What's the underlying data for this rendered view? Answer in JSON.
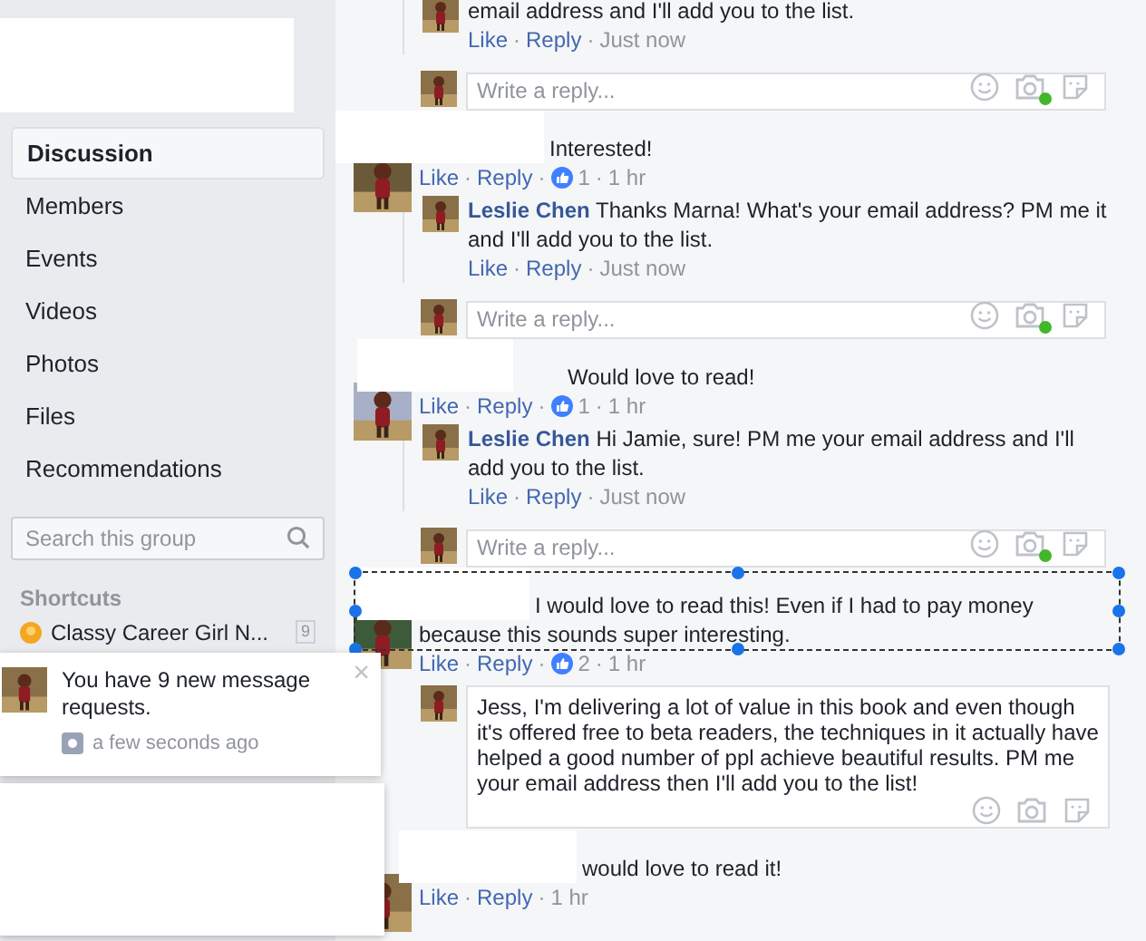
{
  "sidebar": {
    "nav": [
      {
        "label": "Discussion",
        "selected": true
      },
      {
        "label": "Members",
        "selected": false
      },
      {
        "label": "Events",
        "selected": false
      },
      {
        "label": "Videos",
        "selected": false
      },
      {
        "label": "Photos",
        "selected": false
      },
      {
        "label": "Files",
        "selected": false
      },
      {
        "label": "Recommendations",
        "selected": false
      }
    ],
    "search": {
      "placeholder": "Search this group"
    },
    "shortcuts": {
      "title": "Shortcuts",
      "items": [
        {
          "name": "Classy Career Girl N...",
          "count": "9"
        }
      ]
    }
  },
  "notification": {
    "text": "You have 9 new message requests.",
    "time": "a few seconds ago",
    "close": "×"
  },
  "earlier": {
    "reply": {
      "text": "email address and I'll add you to the list.",
      "actions": [
        {
          "kind": "link",
          "text": "Like"
        },
        {
          "kind": "sep",
          "text": "·"
        },
        {
          "kind": "link",
          "text": "Reply"
        },
        {
          "kind": "sep",
          "text": "·"
        },
        {
          "kind": "time",
          "text": "Just now"
        }
      ]
    },
    "composer": {
      "placeholder": "Write a reply...",
      "online": true
    }
  },
  "comments": [
    {
      "text": "Interested!",
      "selected": false,
      "actions": [
        {
          "kind": "link",
          "text": "Like"
        },
        {
          "kind": "sep",
          "text": "·"
        },
        {
          "kind": "link",
          "text": "Reply"
        },
        {
          "kind": "sep",
          "text": "·"
        },
        {
          "kind": "reactions",
          "text": "1"
        },
        {
          "kind": "sep",
          "text": "·"
        },
        {
          "kind": "time",
          "text": "1 hr"
        }
      ],
      "replies": [
        {
          "author": "Leslie Chen",
          "text": "Thanks Marna! What's your email address? PM me it and I'll add you to the list.",
          "actions": [
            {
              "kind": "link",
              "text": "Like"
            },
            {
              "kind": "sep",
              "text": "·"
            },
            {
              "kind": "link",
              "text": "Reply"
            },
            {
              "kind": "sep",
              "text": "·"
            },
            {
              "kind": "time",
              "text": "Just now"
            }
          ]
        }
      ],
      "composer": {
        "placeholder": "Write a reply...",
        "online": true
      }
    },
    {
      "text": "Would love to read!",
      "selected": false,
      "actions": [
        {
          "kind": "link",
          "text": "Like"
        },
        {
          "kind": "sep",
          "text": "·"
        },
        {
          "kind": "link",
          "text": "Reply"
        },
        {
          "kind": "sep",
          "text": "·"
        },
        {
          "kind": "reactions",
          "text": "1"
        },
        {
          "kind": "sep",
          "text": "·"
        },
        {
          "kind": "time",
          "text": "1 hr"
        }
      ],
      "replies": [
        {
          "author": "Leslie Chen",
          "text": "Hi Jamie, sure! PM me your email address and I'll add you to the list.",
          "actions": [
            {
              "kind": "link",
              "text": "Like"
            },
            {
              "kind": "sep",
              "text": "·"
            },
            {
              "kind": "link",
              "text": "Reply"
            },
            {
              "kind": "sep",
              "text": "·"
            },
            {
              "kind": "time",
              "text": "Just now"
            }
          ]
        }
      ],
      "composer": {
        "placeholder": "Write a reply...",
        "online": true
      }
    },
    {
      "text": "I would love to read this! Even if I had to pay money because this sounds super interesting.",
      "selected": true,
      "actions": [
        {
          "kind": "link",
          "text": "Like"
        },
        {
          "kind": "sep",
          "text": "·"
        },
        {
          "kind": "link",
          "text": "Reply"
        },
        {
          "kind": "sep",
          "text": "·"
        },
        {
          "kind": "reactions",
          "text": "2"
        },
        {
          "kind": "sep",
          "text": "·"
        },
        {
          "kind": "time",
          "text": "1 hr"
        }
      ],
      "composer": {
        "value": "Jess, I'm delivering a lot of value in this book and even though it's offered free to beta readers, the techniques in it actually have helped a good number of ppl achieve beautiful results. PM me your email address then I'll add you to the list!",
        "online": false
      }
    },
    {
      "text": "would love to read it!",
      "selected": false,
      "actions": [
        {
          "kind": "link",
          "text": "Like"
        },
        {
          "kind": "sep",
          "text": "·"
        },
        {
          "kind": "link",
          "text": "Reply"
        },
        {
          "kind": "sep",
          "text": "·"
        },
        {
          "kind": "time",
          "text": "1 hr"
        }
      ]
    }
  ]
}
